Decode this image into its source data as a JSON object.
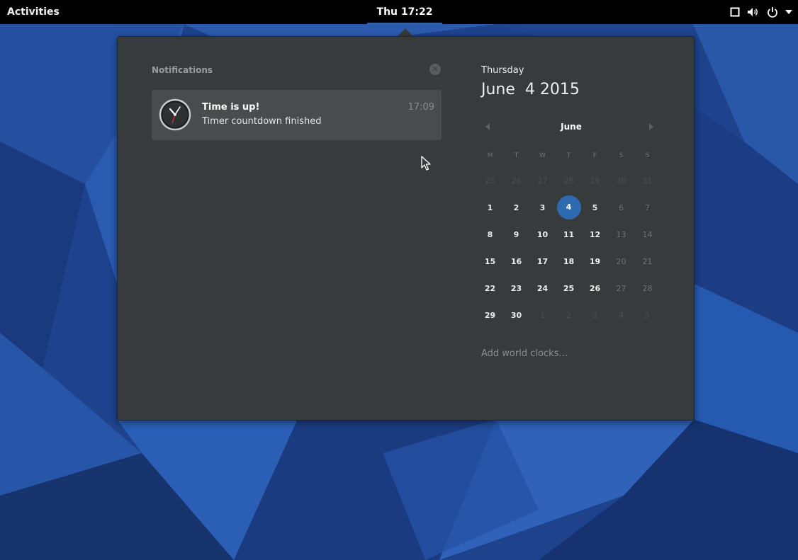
{
  "topbar": {
    "activities_label": "Activities",
    "clock_label": "Thu 17:22",
    "tray_icons": [
      "window-icon",
      "volume-icon",
      "power-icon",
      "dropdown-arrow-icon"
    ]
  },
  "notifications": {
    "heading": "Notifications",
    "items": [
      {
        "icon": "clock-app-icon",
        "title": "Time is up!",
        "body": "Timer countdown finished",
        "time": "17:09"
      }
    ]
  },
  "calendar": {
    "weekday": "Thursday",
    "full_date": "June  4 2015",
    "month": "June",
    "day_headers": [
      "M",
      "T",
      "W",
      "T",
      "F",
      "S",
      "S"
    ],
    "weeks": [
      [
        "25",
        "26",
        "27",
        "28",
        "29",
        "30",
        "31"
      ],
      [
        "1",
        "2",
        "3",
        "4",
        "5",
        "6",
        "7"
      ],
      [
        "8",
        "9",
        "10",
        "11",
        "12",
        "13",
        "14"
      ],
      [
        "15",
        "16",
        "17",
        "18",
        "19",
        "20",
        "21"
      ],
      [
        "22",
        "23",
        "24",
        "25",
        "26",
        "27",
        "28"
      ],
      [
        "29",
        "30",
        "1",
        "2",
        "3",
        "4",
        "5"
      ]
    ],
    "selected_day": "4",
    "world_clocks_label": "Add world clocks…"
  },
  "colors": {
    "accent": "#2d6ab0",
    "panel": "#383b3c",
    "topbar": "#000000"
  }
}
